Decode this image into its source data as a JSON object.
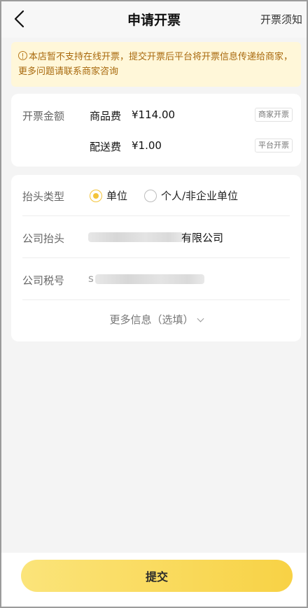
{
  "nav": {
    "title": "申请开票",
    "right_link": "开票须知"
  },
  "notice": {
    "text": "本店暂不支持在线开票，提交开票后平台将开票信息传递给商家，更多问题请联系商家咨询"
  },
  "amount_card": {
    "label": "开票金额",
    "items": [
      {
        "name": "商品费",
        "amount": "¥114.00",
        "tag": "商家开票"
      },
      {
        "name": "配送费",
        "amount": "¥1.00",
        "tag": "平台开票"
      }
    ]
  },
  "title_card": {
    "type_label": "抬头类型",
    "options": [
      {
        "label": "单位",
        "checked": true
      },
      {
        "label": "个人/非企业单位",
        "checked": false
      }
    ],
    "company_label": "公司抬头",
    "company_value_suffix": "有限公司",
    "tax_label": "公司税号",
    "tax_value_visible": "s",
    "more_label": "更多信息（选填）"
  },
  "submit": {
    "label": "提交"
  },
  "colors": {
    "accent": "#f3c43a",
    "notice_bg": "#fff7d9",
    "notice_text": "#a8690d"
  }
}
